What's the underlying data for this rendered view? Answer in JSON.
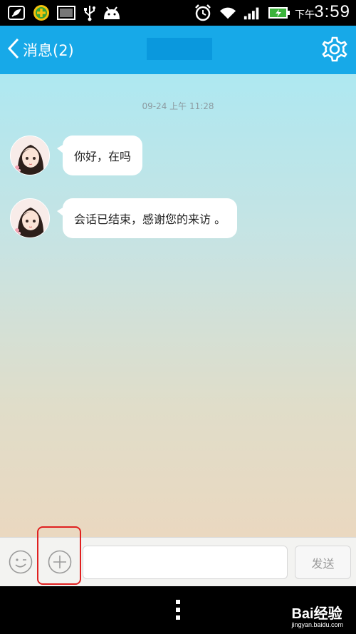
{
  "status_bar": {
    "ampm": "下午",
    "time": "3:59",
    "icons": [
      "leaf-icon",
      "shield-plus-icon",
      "image-icon",
      "usb-icon",
      "android-icon",
      "alarm-icon",
      "wifi-icon",
      "signal-icon",
      "battery-charging-icon"
    ]
  },
  "header": {
    "back_label": "消息(2)",
    "settings_icon": "gear-icon"
  },
  "chat": {
    "timestamp": "09-24 上午 11:28",
    "messages": [
      {
        "text": "你好，在吗"
      },
      {
        "text": "会话已结束，感谢您的来访 。"
      }
    ]
  },
  "input_bar": {
    "placeholder": "",
    "send_label": "发送"
  },
  "watermark": {
    "brand": "Bai经验",
    "url": "jingyan.baidu.com"
  },
  "colors": {
    "header": "#17a9e8",
    "highlight": "#e02020"
  }
}
